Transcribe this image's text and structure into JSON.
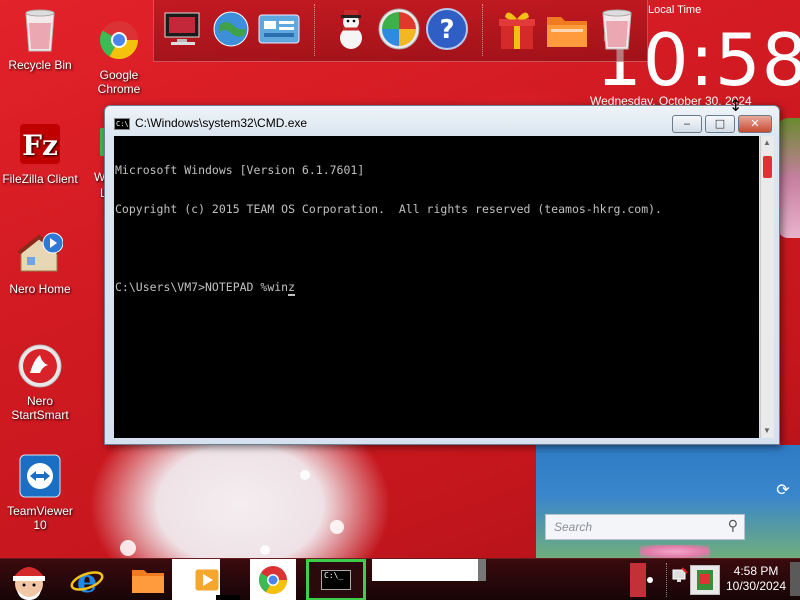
{
  "desktop": {
    "icons": [
      {
        "label": "Recycle Bin",
        "icon": "recycle-bin-icon"
      },
      {
        "label": "Google Chrome",
        "icon": "chrome-icon"
      },
      {
        "label": "FileZilla Client",
        "icon": "filezilla-icon"
      },
      {
        "label": "Nero Home",
        "icon": "nero-home-icon"
      },
      {
        "label": "Nero StartSmart",
        "icon": "nero-startsmart-icon"
      },
      {
        "label": "TeamViewer 10",
        "icon": "teamviewer-icon"
      }
    ],
    "partial_icon_labels": [
      "W",
      "L"
    ]
  },
  "clock_widget": {
    "label": "Local Time",
    "time": "10:58",
    "date": "Wednesday, October 30, 2024"
  },
  "search_widget": {
    "placeholder": "Search"
  },
  "dock": {
    "icons": [
      "computer-icon",
      "globe-icon",
      "control-panel-icon",
      "snowman-icon",
      "windows-orb-icon",
      "help-icon",
      "gift-icon",
      "folder-icon",
      "recycle-bin-icon"
    ]
  },
  "cmd_window": {
    "title": "C:\\Windows\\system32\\CMD.exe",
    "icon_text": "C:\\",
    "lines": [
      "Microsoft Windows [Version 6.1.7601]",
      "Copyright (c) 2015 TEAM OS Corporation.  All rights reserved (teamos-hkrg.com).",
      "",
      "C:\\Users\\VM7>NOTEPAD %win"
    ],
    "buttons": {
      "minimize": "‒",
      "maximize": "□",
      "close": "✕"
    }
  },
  "taskbar": {
    "start_icon": "santa-start-icon",
    "pinned": [
      "internet-explorer-icon",
      "file-explorer-icon",
      "media-player-icon",
      "chrome-icon",
      "cmd-icon"
    ],
    "cmd_icon_text": "C:\\_",
    "tray_time": "4:58 PM",
    "tray_date": "10/30/2024"
  },
  "colors": {
    "wallpaper_red": "#d8191f",
    "taskbar": "#1d0607",
    "console_bg": "#000000",
    "console_fg": "#c0c0c0",
    "active_task_border": "#3ecf4a"
  }
}
